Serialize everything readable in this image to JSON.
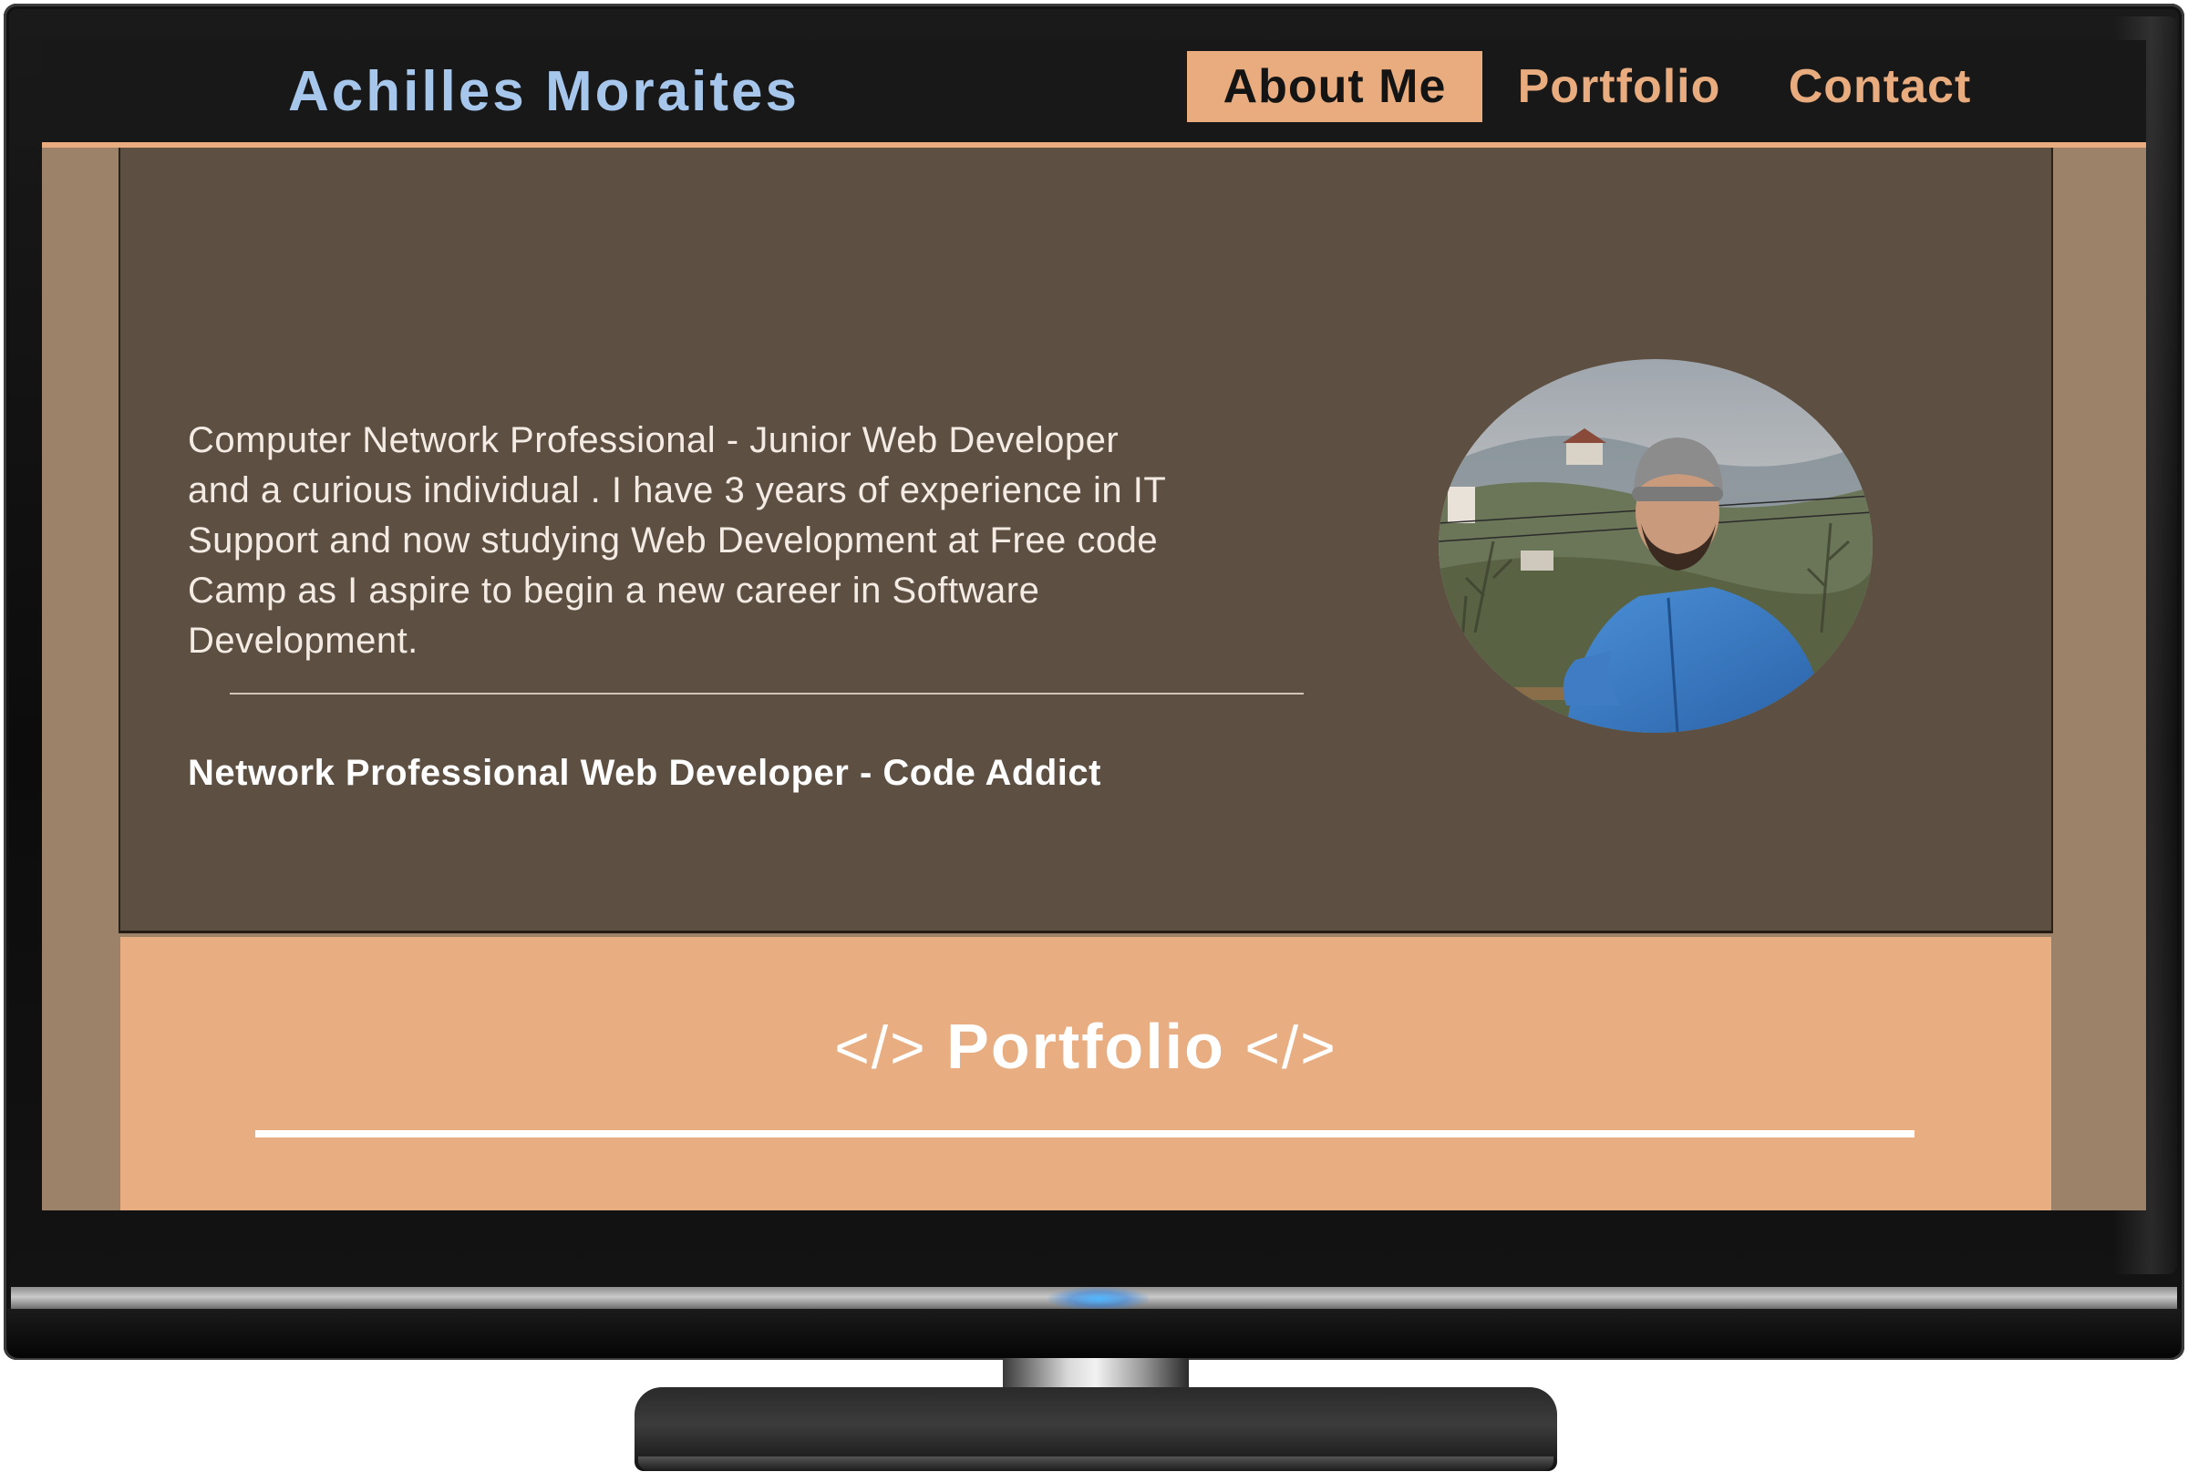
{
  "site": {
    "brand": "Achilles Moraites",
    "nav": [
      {
        "label": "About Me",
        "active": true
      },
      {
        "label": "Portfolio",
        "active": false
      },
      {
        "label": "Contact",
        "active": false
      }
    ]
  },
  "about": {
    "bio_lines": [
      "Computer Network Professional - Junior Web Developer",
      "and a curious individual . I have 3 years of experience in IT",
      "Support and now studying Web Development at Free code",
      "Camp as I aspire to begin a new career in Software",
      "Development."
    ],
    "tagline": "Network Professional Web Developer - Code Addict",
    "photo_icon": "profile-photo"
  },
  "portfolio": {
    "code_icon": "</>",
    "title": "Portfolio"
  },
  "colors": {
    "accent": "#e8ac7e",
    "brand": "#a6c6ec",
    "navbar": "#181818",
    "about_bg": "#5d4f41",
    "side_bg": "#9c8268"
  }
}
